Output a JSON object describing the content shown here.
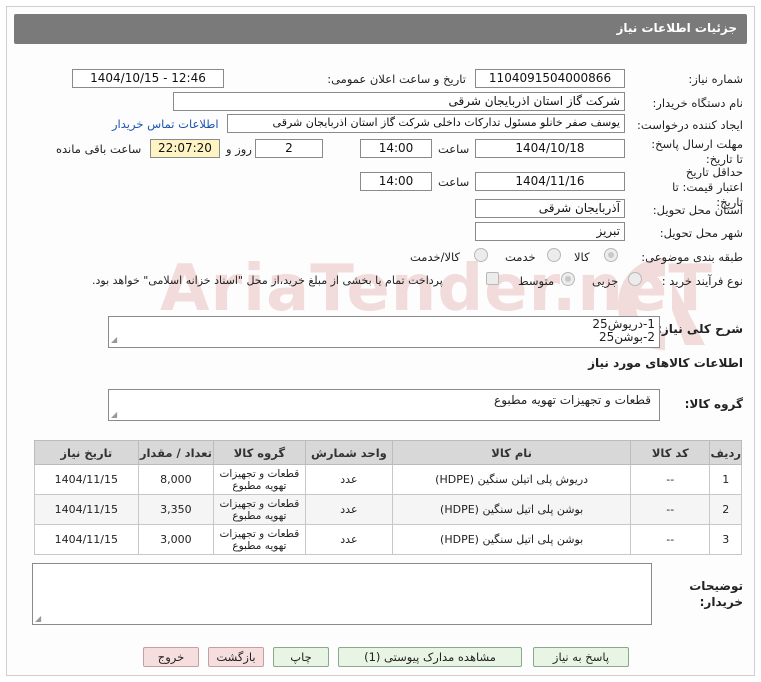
{
  "header": {
    "title": "جزئیات اطلاعات نیاز"
  },
  "form": {
    "need_number_label": "شماره نیاز:",
    "need_number": "1104091504000866",
    "announce_label": "تاریخ و ساعت اعلان عمومی:",
    "announce_value": "1404/10/15 - 12:46",
    "buyer_org_label": "نام دستگاه خریدار:",
    "buyer_org": "شرکت گاز استان اذربایجان شرقی",
    "creator_label": "ایجاد کننده درخواست:",
    "creator": "یوسف صفر خانلو  مسئول تدارکات داخلی  شرکت گاز استان اذربایجان شرقی",
    "contact_link": "اطلاعات تماس خریدار",
    "reply_deadline_label": "مهلت ارسال پاسخ: تا تاریخ:",
    "reply_date": "1404/10/18",
    "time_label": "ساعت",
    "reply_time": "14:00",
    "days": "2",
    "days_label": "روز و",
    "remaining": "22:07:20",
    "remaining_label": "ساعت باقی مانده",
    "validity_label": "حداقل تاریخ اعتبار قیمت: تا تاریخ:",
    "validity_date": "1404/11/16",
    "validity_time_label": "ساعت",
    "validity_time": "14:00",
    "province_label": "استان محل تحویل:",
    "province": "آذربایجان شرقی",
    "city_label": "شهر محل تحویل:",
    "city": "تبریز",
    "category_label": "طبقه بندی موضوعی:",
    "category_options": [
      "کالا",
      "خدمت",
      "کالا/خدمت"
    ],
    "process_label": "نوع فرآیند خرید :",
    "process_options": [
      "جزیی",
      "متوسط"
    ],
    "payment_note": "پرداخت تمام یا بخشی از مبلغ خرید،از محل \"اسناد خزانه اسلامی\" خواهد بود."
  },
  "summary": {
    "label": "شرح کلی نیاز:",
    "line1": "1-دریوش25",
    "line2": "2-بوشن25"
  },
  "goods": {
    "section_title": "اطلاعات کالاهای مورد نیاز",
    "group_label": "گروه کالا:",
    "group_value": "قطعات و تجهیزات تهویه مطبوع"
  },
  "table": {
    "headers": [
      "ردیف",
      "کد کالا",
      "نام کالا",
      "واحد شمارش",
      "گروه کالا",
      "تعداد / مقدار",
      "تاریخ نیاز"
    ],
    "rows": [
      {
        "row": "1",
        "code": "--",
        "name": "دریوش پلی اتیلن سنگین (HDPE)",
        "unit": "عدد",
        "group": "قطعات و تجهیزات تهویه مطبوع",
        "qty": "8,000",
        "date": "1404/11/15"
      },
      {
        "row": "2",
        "code": "--",
        "name": "بوشن پلی اتیل سنگین (HDPE)",
        "unit": "عدد",
        "group": "قطعات و تجهیزات تهویه مطبوع",
        "qty": "3,350",
        "date": "1404/11/15"
      },
      {
        "row": "3",
        "code": "--",
        "name": "بوشن پلی اتیل سنگین (HDPE)",
        "unit": "عدد",
        "group": "قطعات و تجهیزات تهویه مطبوع",
        "qty": "3,000",
        "date": "1404/11/15"
      }
    ]
  },
  "notes": {
    "label": "توضیحات خریدار:",
    "value": ""
  },
  "buttons": {
    "reply": "پاسخ به نیاز",
    "attachments": "مشاهده مدارک پیوستی (1)",
    "print": "چاپ",
    "back": "بازگشت",
    "exit": "خروج"
  },
  "watermark": {
    "text": "AriaTender.neT"
  },
  "colors": {
    "header": "#7a7a7a",
    "link": "#1a55b0",
    "table_header": "#d8d8d8",
    "button_green": "#e8f5e4",
    "button_pink": "#f6dede",
    "remaining_bg": "#fdf3c3"
  }
}
